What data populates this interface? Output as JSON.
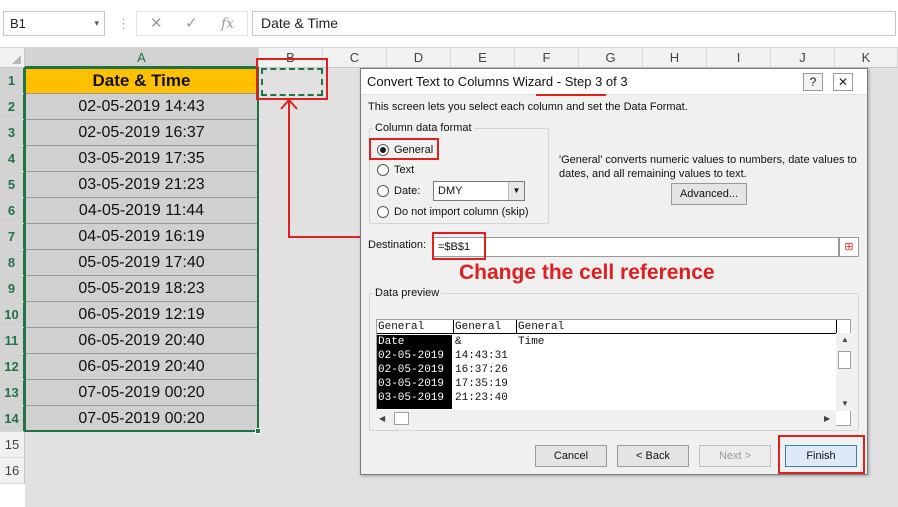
{
  "namebox": {
    "value": "B1",
    "dropdown": "▾"
  },
  "formula_bar": {
    "separator": "⋮",
    "cancel_icon": "✕",
    "enter_icon": "✓",
    "fx_label": "fx",
    "value": "Date & Time"
  },
  "columns": [
    "A",
    "B",
    "C",
    "D",
    "E",
    "F",
    "G",
    "H",
    "I",
    "J",
    "K"
  ],
  "rows": [
    "1",
    "2",
    "3",
    "4",
    "5",
    "6",
    "7",
    "8",
    "9",
    "10",
    "11",
    "12",
    "13",
    "14",
    "15",
    "16"
  ],
  "column_a": {
    "header": "Date & Time",
    "values": [
      "02-05-2019 14:43",
      "02-05-2019 16:37",
      "03-05-2019 17:35",
      "03-05-2019 21:23",
      "04-05-2019 11:44",
      "04-05-2019 16:19",
      "05-05-2019 17:40",
      "05-05-2019 18:23",
      "06-05-2019 12:19",
      "06-05-2019 20:40",
      "06-05-2019 20:40",
      "07-05-2019 00:20",
      "07-05-2019 00:20"
    ]
  },
  "dialog": {
    "title": "Convert Text to Columns Wizard - Step 3 of 3",
    "help_button": "?",
    "close_button": "✕",
    "intro": "This screen lets you select each column and set the Data Format.",
    "format_group_label": "Column data format",
    "radios": {
      "general": "General",
      "text": "Text",
      "date": "Date:",
      "skip": "Do not import column (skip)"
    },
    "date_format": "DMY",
    "date_dropdown_arrow": "▼",
    "general_note": "'General' converts numeric values to numbers, date values to dates, and all remaining values to text.",
    "advanced_button": "Advanced...",
    "destination_label": "Destination:",
    "destination_value": "=$B$1",
    "ref_button": "⊞",
    "preview_label": "Data preview",
    "preview_headers": [
      "General",
      "General",
      "General"
    ],
    "preview_rows": [
      [
        "Date",
        "&",
        "Time"
      ],
      [
        "02-05-2019",
        "14:43:31",
        ""
      ],
      [
        "02-05-2019",
        "16:37:26",
        ""
      ],
      [
        "03-05-2019",
        "17:35:19",
        ""
      ],
      [
        "03-05-2019",
        "21:23:40",
        ""
      ]
    ],
    "buttons": {
      "cancel": "Cancel",
      "back": "< Back",
      "next": "Next >",
      "finish": "Finish"
    }
  },
  "annotation": {
    "callout": "Change the cell reference",
    "color": "#e02020"
  },
  "colors": {
    "header_fill": "#ffc000",
    "data_fill": "#d0d0d0",
    "excel_green": "#217346"
  }
}
